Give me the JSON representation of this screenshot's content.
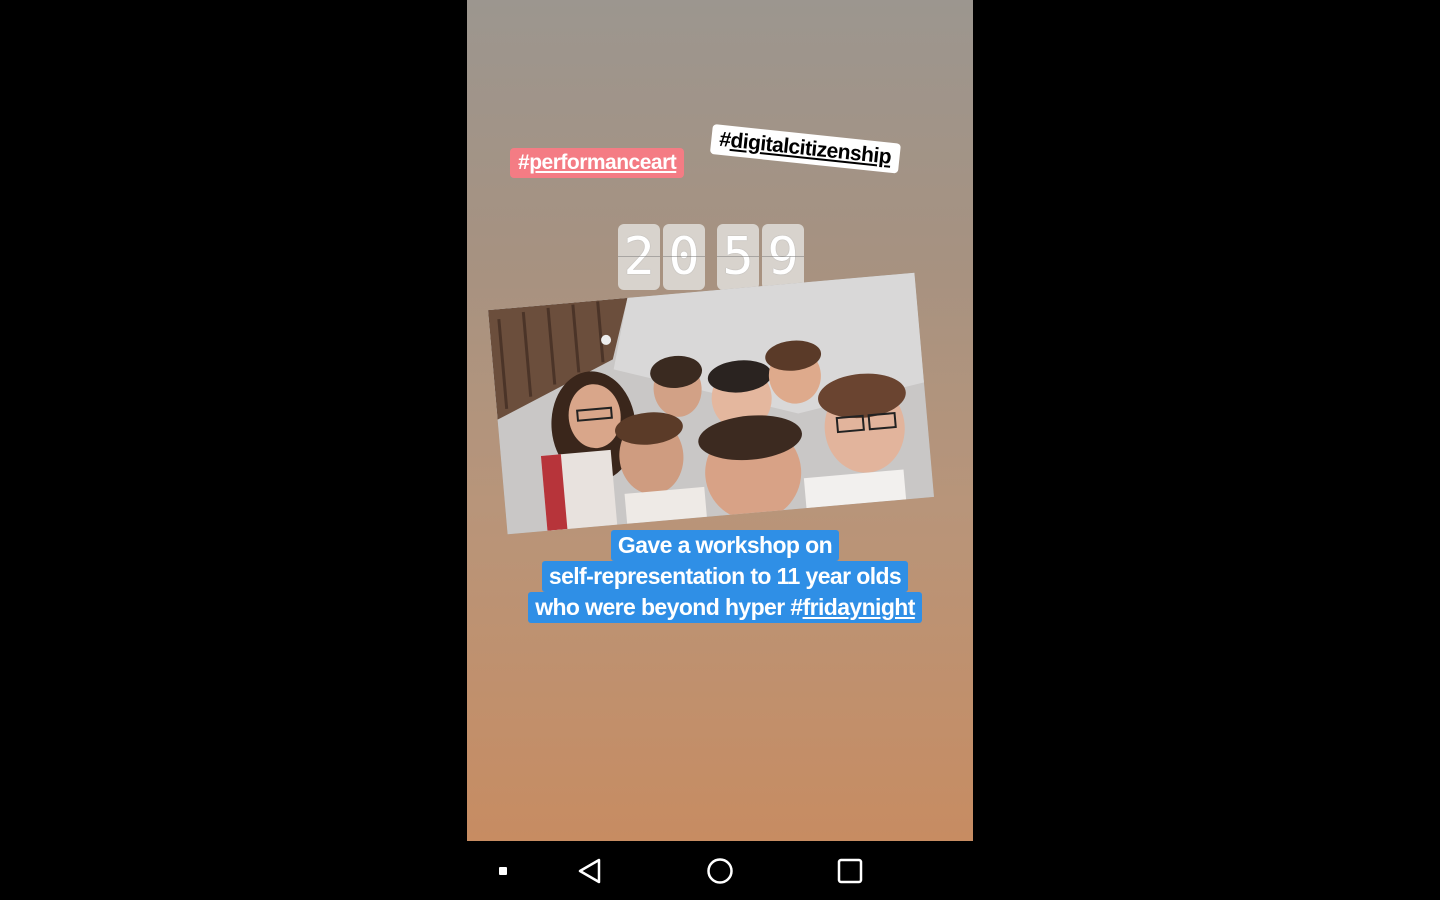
{
  "story": {
    "tags": {
      "performance": {
        "hash": "#",
        "word": "performanceart"
      },
      "digital": {
        "hash": "#",
        "word": "digitalcitizenship"
      }
    },
    "countdown": {
      "d1": "2",
      "d2": "0",
      "d3": "5",
      "d4": "9"
    },
    "photo": {
      "icon": "group-selfie-photo"
    },
    "caption": {
      "line1": "Gave a workshop on",
      "line2": "self-representation to 11 year olds",
      "line3_prefix": "who were beyond hyper #",
      "line3_link": "fridaynight"
    },
    "colors": {
      "performance_tag": "#f47c84",
      "caption_bg": "#2f8fe6"
    }
  },
  "navbar": {
    "icons": [
      "dot-icon",
      "back-icon",
      "home-icon",
      "recents-icon"
    ]
  }
}
